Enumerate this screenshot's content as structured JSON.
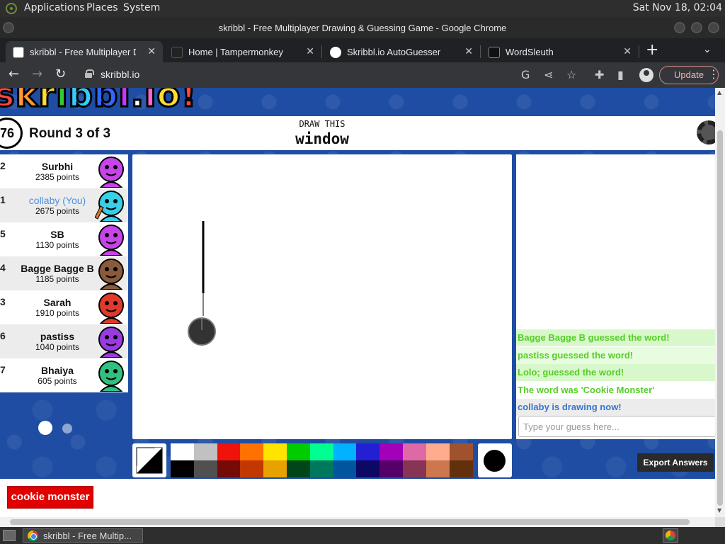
{
  "topbar": {
    "menus": [
      "Applications",
      "Places",
      "System"
    ],
    "clock": "Sat Nov 18, 02:04"
  },
  "window": {
    "title": "skribbl - Free Multiplayer Drawing & Guessing Game - Google Chrome"
  },
  "tabs": [
    {
      "label": "skribbl - Free Multiplayer Drawing & Guessing Game",
      "active": true
    },
    {
      "label": "Home | Tampermonkey",
      "active": false
    },
    {
      "label": "Skribbl.io AutoGuesser",
      "active": false
    },
    {
      "label": "WordSleuth",
      "active": false
    }
  ],
  "toolbar": {
    "url": "skribbl.io",
    "update_label": "Update"
  },
  "game": {
    "logo_text": "skribbl.io!",
    "timer": "76",
    "round": "Round 3 of 3",
    "draw_this_label": "DRAW THIS",
    "word": "window",
    "players": [
      {
        "rank": "2",
        "name": "Surbhi",
        "points": "2385 points",
        "avatar_color": "#c844e8",
        "you": false,
        "drawing": false
      },
      {
        "rank": "1",
        "name": "collaby (You)",
        "points": "2675 points",
        "avatar_color": "#38d0e8",
        "you": true,
        "drawing": true
      },
      {
        "rank": "5",
        "name": "SB",
        "points": "1130 points",
        "avatar_color": "#c844e8",
        "you": false,
        "drawing": false
      },
      {
        "rank": "4",
        "name": "Bagge Bagge B",
        "points": "1185 points",
        "avatar_color": "#8a5a3c",
        "you": false,
        "drawing": false
      },
      {
        "rank": "3",
        "name": "Sarah",
        "points": "1910 points",
        "avatar_color": "#e03a2a",
        "you": false,
        "drawing": false
      },
      {
        "rank": "6",
        "name": "pastiss",
        "points": "1040 points",
        "avatar_color": "#9a3ae0",
        "you": false,
        "drawing": false
      },
      {
        "rank": "7",
        "name": "Bhaiya",
        "points": "605 points",
        "avatar_color": "#30c080",
        "you": false,
        "drawing": false
      }
    ],
    "chat": [
      {
        "text": "Bagge Bagge B guessed the word!",
        "color": "#56ce27",
        "bg": "#d8f8cc"
      },
      {
        "text": "pastiss guessed the word!",
        "color": "#56ce27",
        "bg": "#e8fce0"
      },
      {
        "text": "Lolo; guessed the word!",
        "color": "#56ce27",
        "bg": "#d8f8cc"
      },
      {
        "text": "The word was 'Cookie Monster'",
        "color": "#56ce27",
        "bg": "#ffffff"
      },
      {
        "text": "collaby is drawing now!",
        "color": "#3975ce",
        "bg": "#ececec"
      }
    ],
    "guess_placeholder": "Type your guess here...",
    "palette": [
      "#ffffff",
      "#c1c1c1",
      "#ef130b",
      "#ff7100",
      "#ffe400",
      "#00cc00",
      "#00ff91",
      "#00b2ff",
      "#231fd3",
      "#a300ba",
      "#df69a7",
      "#ffac8e",
      "#a0522d",
      "#000000",
      "#505050",
      "#740b07",
      "#c23800",
      "#e8a200",
      "#004619",
      "#00785d",
      "#00569e",
      "#0e0865",
      "#550069",
      "#873554",
      "#cc774d",
      "#63300d"
    ],
    "export_label": "Export Answers",
    "hint_button_label": "cookie monster"
  },
  "taskbar": {
    "item_label": "skribbl - Free Multip..."
  }
}
